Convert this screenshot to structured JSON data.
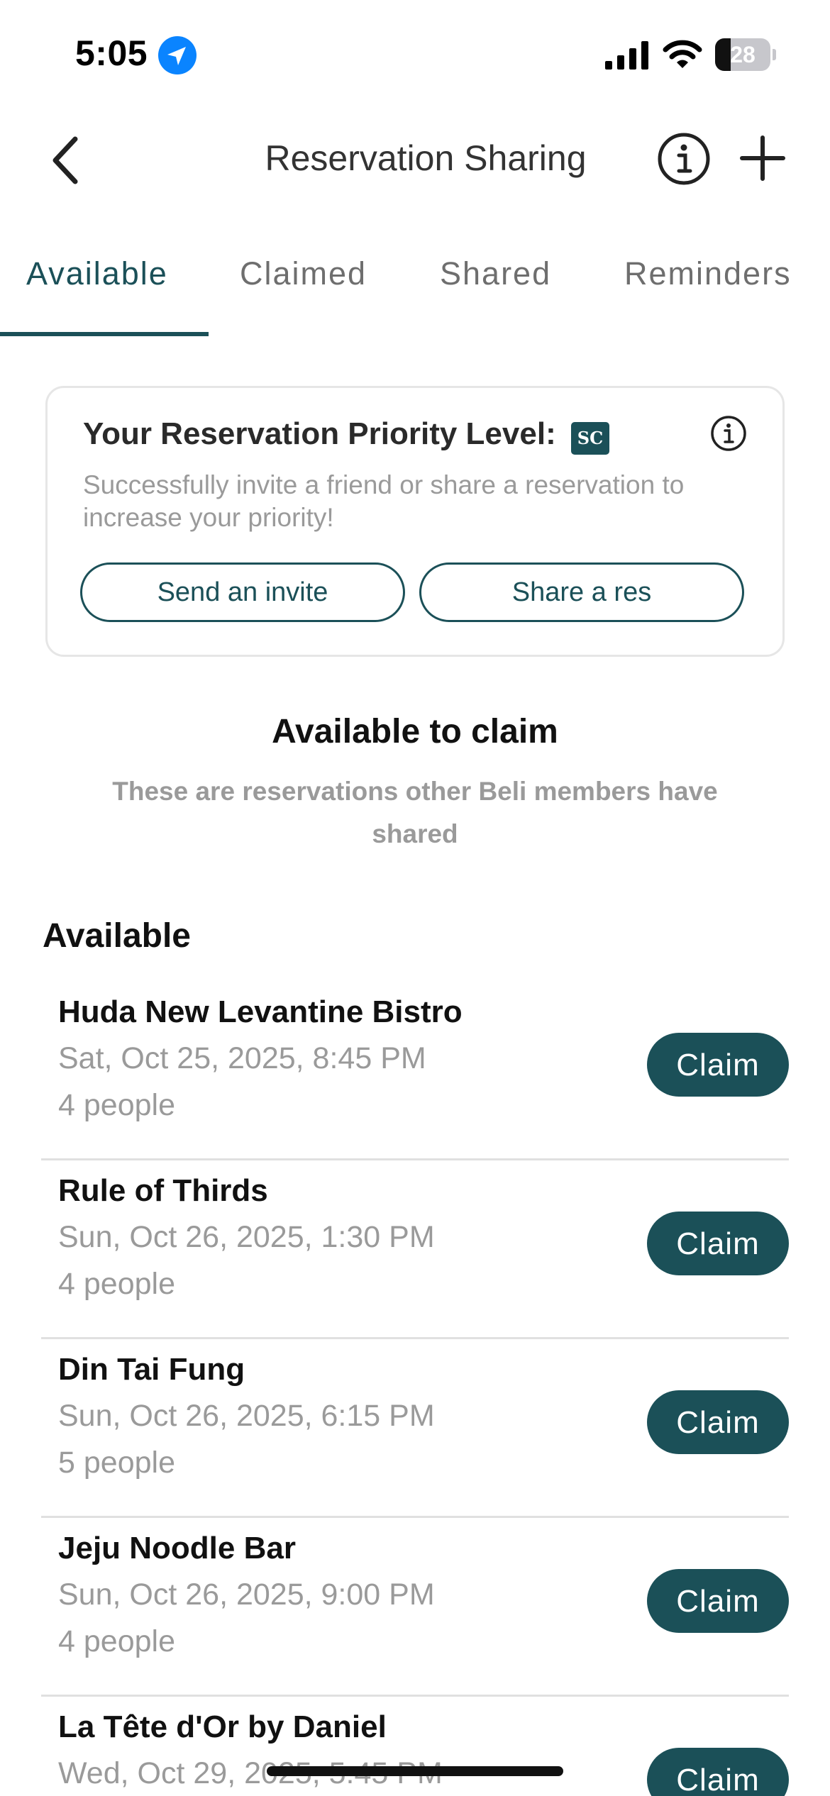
{
  "status_bar": {
    "time": "5:05",
    "battery_level": "28",
    "battery_fraction": 0.28,
    "location_icon": "location-arrow-icon",
    "signal_icon": "cellular-signal-icon",
    "wifi_icon": "wifi-icon"
  },
  "nav": {
    "title": "Reservation Sharing",
    "back_icon": "chevron-left-icon",
    "info_icon": "info-icon",
    "add_icon": "plus-icon"
  },
  "tabs": [
    {
      "label": "Available",
      "active": true
    },
    {
      "label": "Claimed",
      "active": false
    },
    {
      "label": "Shared",
      "active": false
    },
    {
      "label": "Reminders",
      "active": false
    }
  ],
  "priority_card": {
    "title": "Your Reservation Priority Level:",
    "badge": "SC",
    "description": "Successfully invite a friend or share a reservation to increase your priority!",
    "invite_button": "Send an invite",
    "share_button": "Share a res"
  },
  "section": {
    "title": "Available to claim",
    "subtitle": "These are reservations other Beli members have shared",
    "list_heading": "Available"
  },
  "reservations": [
    {
      "name": "Huda New Levantine Bistro",
      "datetime": "Sat, Oct 25, 2025, 8:45 PM",
      "party": "4 people",
      "action": "Claim"
    },
    {
      "name": "Rule of Thirds",
      "datetime": "Sun, Oct 26, 2025, 1:30 PM",
      "party": "4 people",
      "action": "Claim"
    },
    {
      "name": "Din Tai Fung",
      "datetime": "Sun, Oct 26, 2025, 6:15 PM",
      "party": "5 people",
      "action": "Claim"
    },
    {
      "name": "Jeju Noodle Bar",
      "datetime": "Sun, Oct 26, 2025, 9:00 PM",
      "party": "4 people",
      "action": "Claim"
    },
    {
      "name": "La Tête d'Or by Daniel",
      "datetime": "Wed, Oct 29, 2025, 5:45 PM",
      "party": "",
      "action": "Claim"
    }
  ],
  "colors": {
    "accent": "#1b5058",
    "muted_text": "#9a9a9a",
    "divider": "#e0e0e0"
  }
}
